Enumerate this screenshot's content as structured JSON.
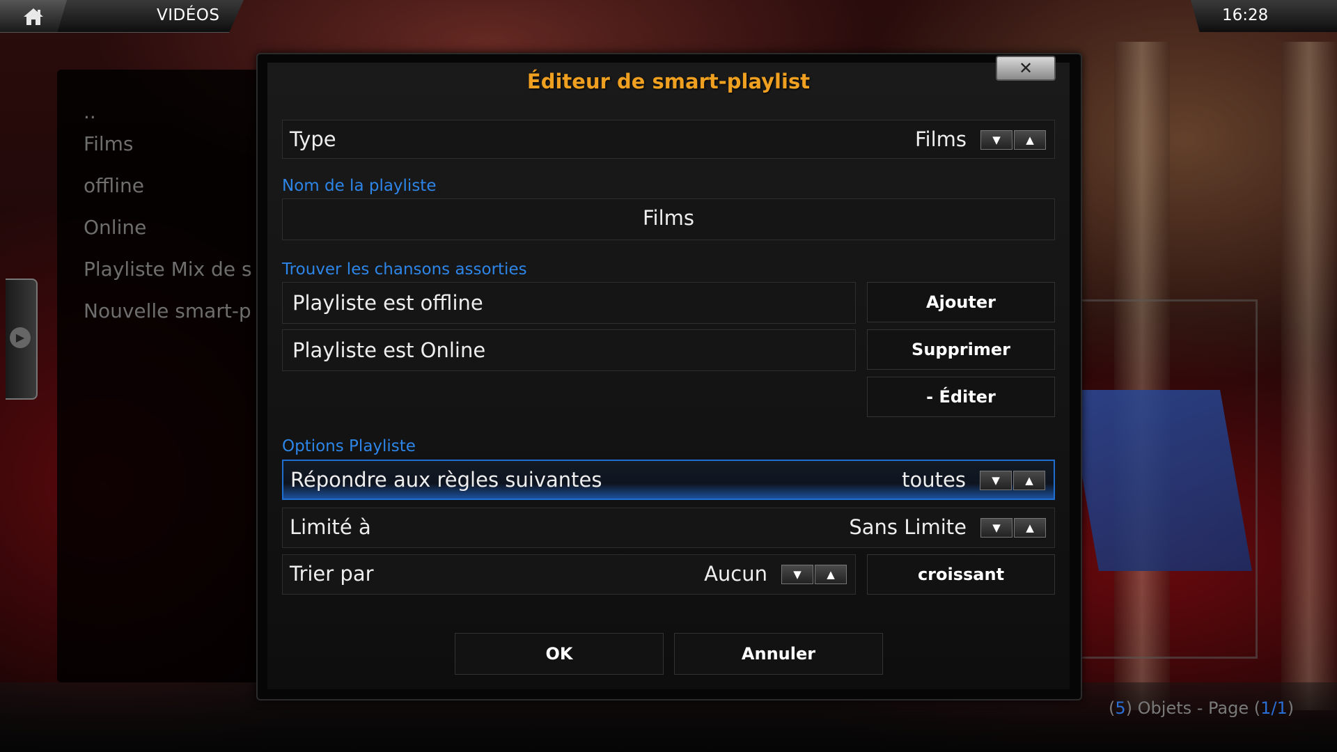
{
  "header": {
    "section_title": "VIDÉOS",
    "clock": "16:28",
    "home_icon": "home-icon"
  },
  "left_list": {
    "items": [
      {
        "label": ".."
      },
      {
        "label": "Films"
      },
      {
        "label": "offline"
      },
      {
        "label": "Online"
      },
      {
        "label": "Playliste Mix de s"
      },
      {
        "label": "Nouvelle smart-p"
      }
    ]
  },
  "footer": {
    "open_paren": "(",
    "count": "5",
    "mid_text": ") Objets - Page (",
    "page": "1/1",
    "close_paren": ")"
  },
  "dialog": {
    "title": "Éditeur de smart-playlist",
    "close_icon": "close-icon",
    "type_row": {
      "label": "Type",
      "value": "Films"
    },
    "name_section": "Nom de la playliste",
    "name_value": "Films",
    "rules_section": "Trouver les chansons assorties",
    "rules": [
      {
        "label": "Playliste est offline"
      },
      {
        "label": "Playliste est Online"
      }
    ],
    "add_label": "Ajouter",
    "remove_label": "Supprimer",
    "edit_label": "- Éditer",
    "options_section": "Options Playliste",
    "match_row": {
      "label": "Répondre aux règles suivantes",
      "value": "toutes"
    },
    "limit_row": {
      "label": "Limité à",
      "value": "Sans Limite"
    },
    "sort_row": {
      "label": "Trier par",
      "value": "Aucun"
    },
    "sort_direction": "croissant",
    "ok_label": "OK",
    "cancel_label": "Annuler",
    "spinner_down": "▼",
    "spinner_up": "▲",
    "close_glyph": "✕"
  },
  "colors": {
    "accent_blue": "#2e85e8",
    "title_orange": "#f0a020",
    "focus_border": "#1f6fd0"
  }
}
